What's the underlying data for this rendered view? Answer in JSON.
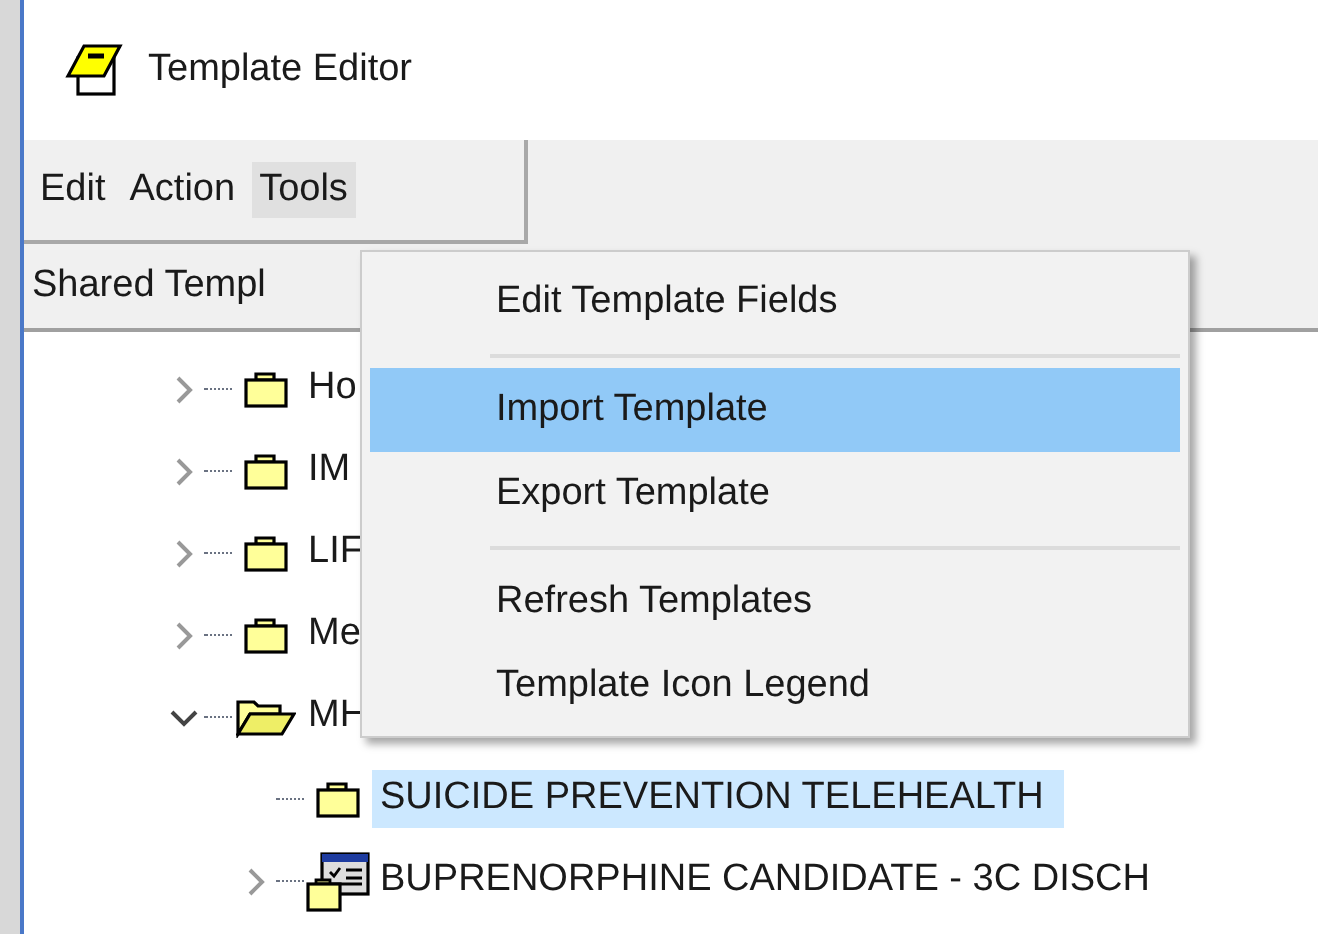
{
  "window": {
    "title": "Template Editor"
  },
  "menu_bar": [
    {
      "label": "Edit",
      "selected": false
    },
    {
      "label": "Action",
      "selected": false
    },
    {
      "label": "Tools",
      "selected": true
    }
  ],
  "panel_header": "Shared Templ",
  "tree": [
    {
      "label": "Ho",
      "kind": "folder",
      "expanded": false,
      "selected": false
    },
    {
      "label": "IM",
      "kind": "folder",
      "expanded": false,
      "selected": false
    },
    {
      "label": "LIF",
      "kind": "folder",
      "expanded": false,
      "selected": false
    },
    {
      "label": "Me",
      "kind": "folder",
      "expanded": false,
      "selected": false
    },
    {
      "label": "MH",
      "kind": "folder",
      "expanded": true,
      "selected": false,
      "children": [
        {
          "label": "SUICIDE PREVENTION TELEHEALTH",
          "kind": "folder",
          "expanded": false,
          "selected": true
        },
        {
          "label": "BUPRENORPHINE CANDIDATE - 3C DISCH",
          "kind": "dialog",
          "expanded": false,
          "selected": false
        }
      ]
    }
  ],
  "dropdown_menu": [
    {
      "kind": "item",
      "label": "Edit Template Fields",
      "selected": false
    },
    {
      "kind": "separator"
    },
    {
      "kind": "item",
      "label": "Import Template",
      "selected": true
    },
    {
      "kind": "item",
      "label": "Export Template",
      "selected": false
    },
    {
      "kind": "separator"
    },
    {
      "kind": "item",
      "label": "Refresh Templates",
      "selected": false
    },
    {
      "kind": "item",
      "label": "Template Icon Legend",
      "selected": false
    }
  ]
}
